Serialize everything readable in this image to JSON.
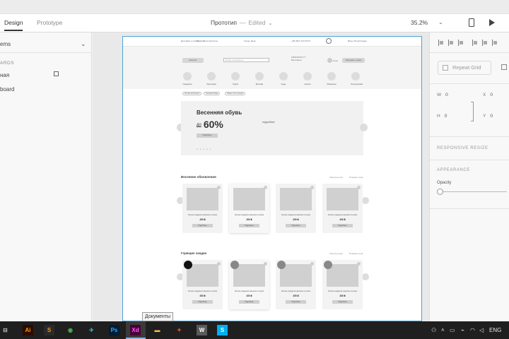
{
  "window": {
    "tabs": [
      {
        "label": "Design",
        "active": true
      },
      {
        "label": "Prototype",
        "active": false
      }
    ],
    "document_title": "Прототип",
    "document_status": "Edited",
    "zoom": "35.2%"
  },
  "left_panel": {
    "section_label": "ems",
    "boards_label": "ARDS",
    "items": [
      "ная",
      "board"
    ]
  },
  "artboard": {
    "nav_links": [
      "Доставка и оплата",
      "Возврат",
      "Блог",
      "Контакты"
    ],
    "nav_city": "Город: Киев",
    "nav_phone": "+38 (067) 123 45 67",
    "nav_account": "Вход / Регистрация",
    "header_button": "Каталог",
    "search_placeholder": "Поиск по каталогу",
    "header_phone": "0 800 50 54 77\nБесплатно",
    "header_toggle_label": "0 грн",
    "header_cart": "Оформить заказ",
    "categories": [
      "Сандалии",
      "Кроссовки",
      "Туфли",
      "Ботинки",
      "Кеды",
      "Сапоги",
      "Мокасины",
      "Полусапожки"
    ],
    "chips": [
      "Летняя коллекция",
      "Осенняя обувь",
      "Новые поступления"
    ],
    "banner": {
      "title": "Весенняя обувь",
      "prefix": "до",
      "discount": "60%",
      "button": "Подробнее",
      "middle_text": "подробнее",
      "dots": "● ● ● ● ●"
    },
    "sections": [
      {
        "title": "Весенние обновления",
        "right_links": [
          "Смотреть все",
          "Показать ещё"
        ],
        "cards": [
          {
            "name": "Летние сандалии женские из кожи",
            "price": "450 ₴",
            "button": "Подробнее",
            "raised": false,
            "badge": ""
          },
          {
            "name": "Летние сандалии женские из кожи",
            "price": "450 ₴",
            "button": "Подробнее",
            "raised": true,
            "badge": ""
          },
          {
            "name": "Летние сандалии женские из кожи",
            "price": "450 ₴",
            "button": "Подробнее",
            "raised": false,
            "badge": ""
          },
          {
            "name": "Летние сандалии женские из кожи",
            "price": "450 ₴",
            "button": "Подробнее",
            "raised": false,
            "badge": ""
          }
        ]
      },
      {
        "title": "Горящие скидки",
        "right_links": [
          "Смотреть все",
          "Показать ещё"
        ],
        "cards": [
          {
            "name": "Летние сандалии женские из кожи",
            "price": "450 ₴",
            "button": "Подробнее",
            "raised": false,
            "badge": "black"
          },
          {
            "name": "Летние сандалии женские из кожи",
            "price": "450 ₴",
            "button": "Подробнее",
            "raised": true,
            "badge": "gray"
          },
          {
            "name": "Летние сандалии женские из кожи",
            "price": "450 ₴",
            "button": "Подробнее",
            "raised": false,
            "badge": "gray"
          },
          {
            "name": "Летние сандалии женские из кожи",
            "price": "450 ₴",
            "button": "Подробнее",
            "raised": false,
            "badge": "gray"
          }
        ]
      }
    ]
  },
  "right_panel": {
    "repeat_grid": "Repeat Grid",
    "w_label": "W",
    "w_value": "0",
    "h_label": "H",
    "h_value": "0",
    "x_label": "X",
    "x_value": "0",
    "y_label": "Y",
    "y_value": "0",
    "responsive_resize": "RESPONSIVE RESIZE",
    "appearance": "APPEARANCE",
    "opacity_label": "Opacity"
  },
  "tooltip": "Документы",
  "taskbar": {
    "apps": [
      {
        "name": "illustrator-icon",
        "glyph": "Ai",
        "bg": "#2b0b00",
        "fg": "#ff9a00"
      },
      {
        "name": "sublime-icon",
        "glyph": "S",
        "bg": "#2a2a2a",
        "fg": "#f79a1c"
      },
      {
        "name": "chrome-icon",
        "glyph": "◉",
        "bg": "#1f1f1f",
        "fg": "#4caf50"
      },
      {
        "name": "bird-icon",
        "glyph": "✈",
        "bg": "#1f1f1f",
        "fg": "#2ec4d6"
      },
      {
        "name": "photoshop-icon",
        "glyph": "Ps",
        "bg": "#001d34",
        "fg": "#31a8ff"
      },
      {
        "name": "xd-icon",
        "glyph": "Xd",
        "bg": "#470137",
        "fg": "#ff61f6"
      },
      {
        "name": "explorer-icon",
        "glyph": "▬",
        "bg": "#1f1f1f",
        "fg": "#f4c542"
      },
      {
        "name": "figma-icon",
        "glyph": "✦",
        "bg": "#1f1f1f",
        "fg": "#f24e1e"
      },
      {
        "name": "wordpress-icon",
        "glyph": "W",
        "bg": "#5a5a5a",
        "fg": "#ffffff"
      },
      {
        "name": "skype-icon",
        "glyph": "S",
        "bg": "#00aff0",
        "fg": "#ffffff"
      }
    ],
    "language": "ENG"
  }
}
